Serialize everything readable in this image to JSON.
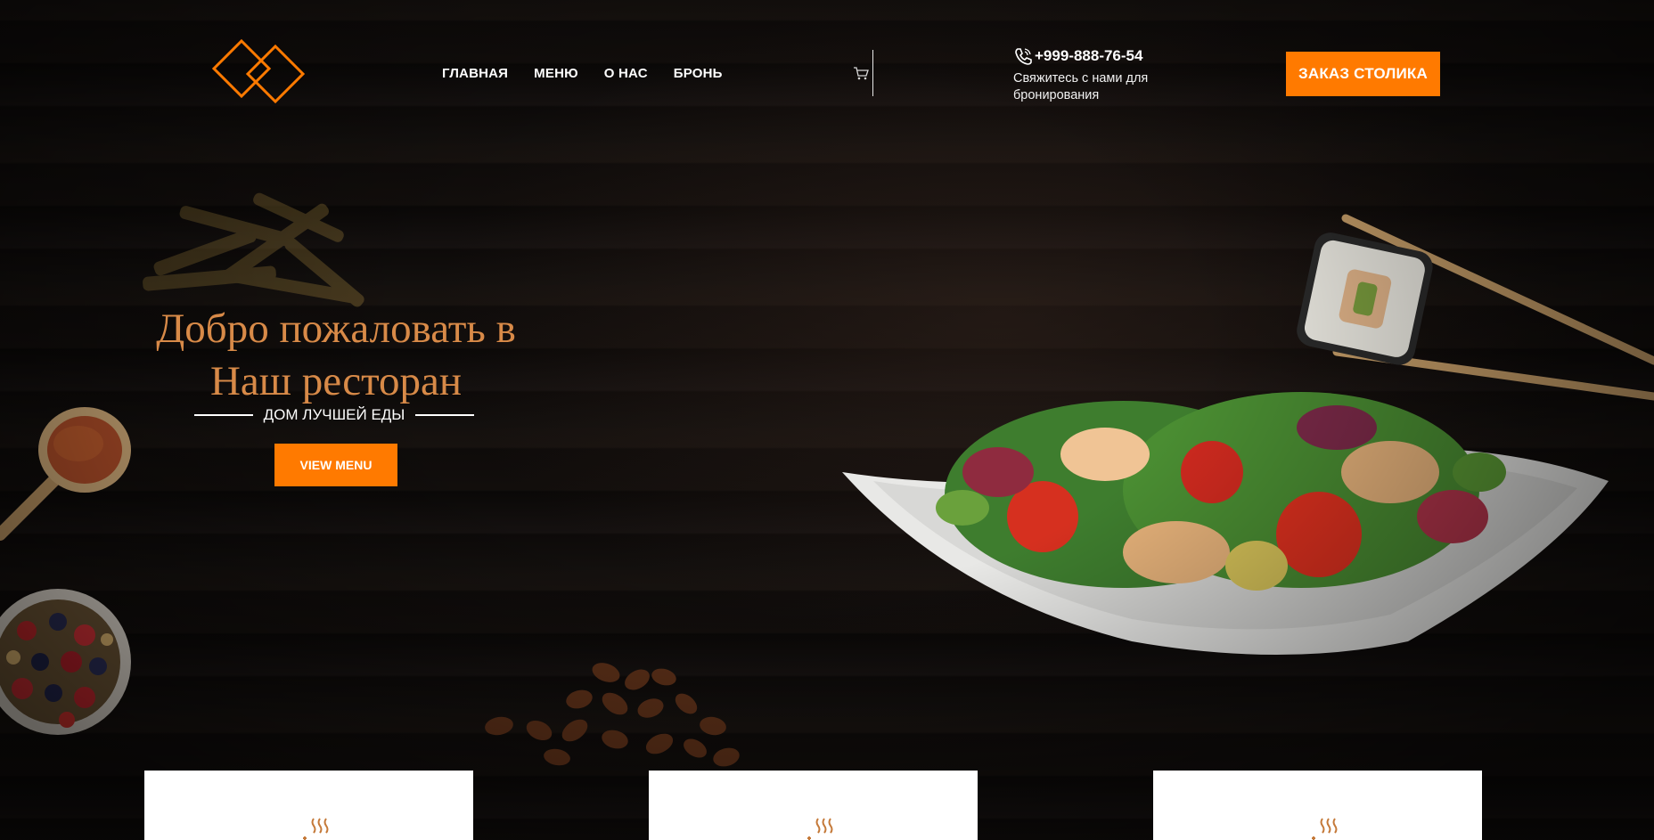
{
  "header": {
    "logo": "logo-diamonds",
    "nav": [
      {
        "label": "ГЛАВНАЯ"
      },
      {
        "label": "МЕНЮ"
      },
      {
        "label": "О НАС"
      },
      {
        "label": "БРОНЬ"
      }
    ],
    "cart_icon": "cart-icon",
    "phone": "+999-888-76-54",
    "phone_caption": "Свяжитесь с нами для бронирования",
    "reserve_button": "ЗАКАЗ СТОЛИКА"
  },
  "hero": {
    "title_line1": "Добро пожаловать в",
    "title_line2": "Наш ресторан",
    "subtitle": "ДОМ ЛУЧШЕЙ ЕДЫ",
    "button": "VIEW MENU"
  },
  "cards": [
    {
      "icon": "steam-dish-icon"
    },
    {
      "icon": "steam-dish-icon"
    },
    {
      "icon": "steam-dish-icon"
    }
  ],
  "colors": {
    "accent": "#ff7a00",
    "title": "#d88a48",
    "background": "#0d0a09"
  }
}
